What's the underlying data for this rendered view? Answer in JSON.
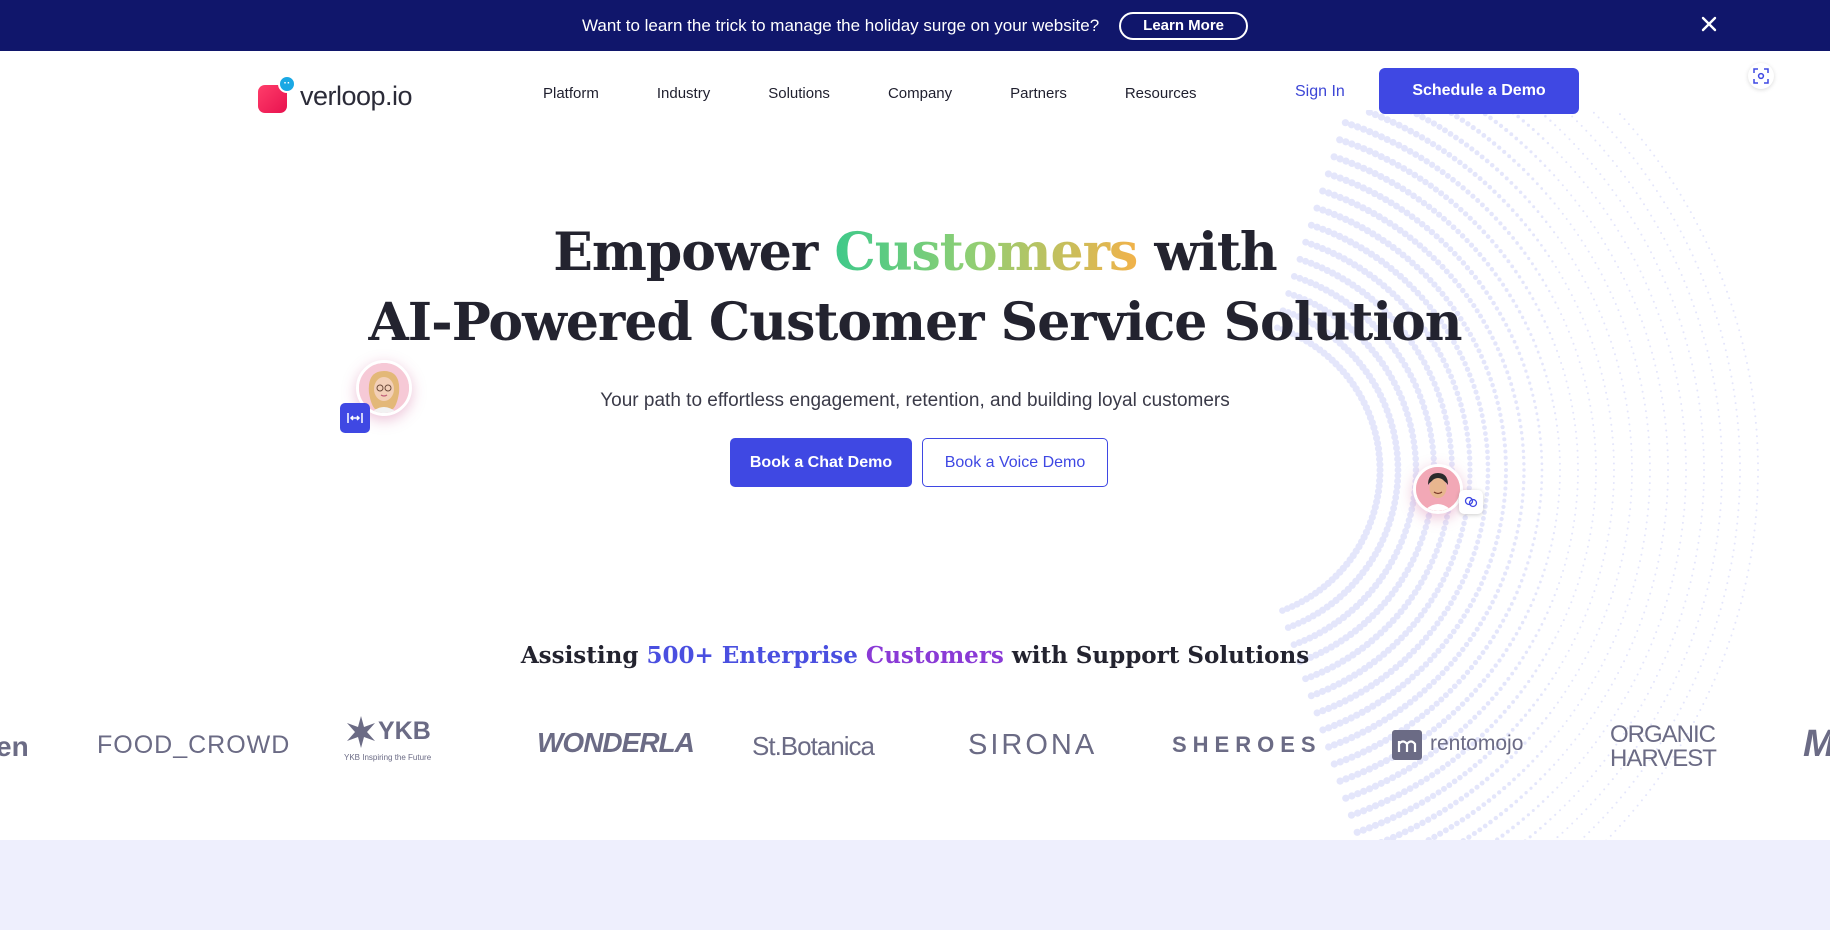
{
  "announcement": {
    "text": "Want to learn the trick to manage the holiday surge on your website?",
    "button": "Learn More"
  },
  "header": {
    "logo_text": "verloop.io",
    "nav": [
      "Platform",
      "Industry",
      "Solutions",
      "Company",
      "Partners",
      "Resources"
    ],
    "sign_in": "Sign In",
    "cta": "Schedule a Demo"
  },
  "hero": {
    "line1_pre": "Empower",
    "line1_highlight": "Customers",
    "line1_post": "with",
    "line2": "AI-Powered Customer Service Solution",
    "subtitle": "Your path to effortless engagement, retention, and building loyal customers",
    "btn_chat": "Book a Chat Demo",
    "btn_voice": "Book a Voice Demo"
  },
  "customers": {
    "title_pre": "Assisting",
    "title_num": "500+ Enterprise",
    "title_highlight": "Customers",
    "title_post": "with Support Solutions",
    "logos": [
      "en",
      "FOOD_CROWD",
      "YKB",
      "WONDERLA",
      "St.Botanica",
      "SIRONA",
      "SHEROES",
      "rentomojo",
      "ORGANIC",
      "HARVEST",
      "M"
    ],
    "ykb_tagline": "YKB Inspiring the Future"
  },
  "colors": {
    "announce_bg": "#10166b",
    "primary": "#3f48e3",
    "band_bg": "#eeeffd"
  }
}
